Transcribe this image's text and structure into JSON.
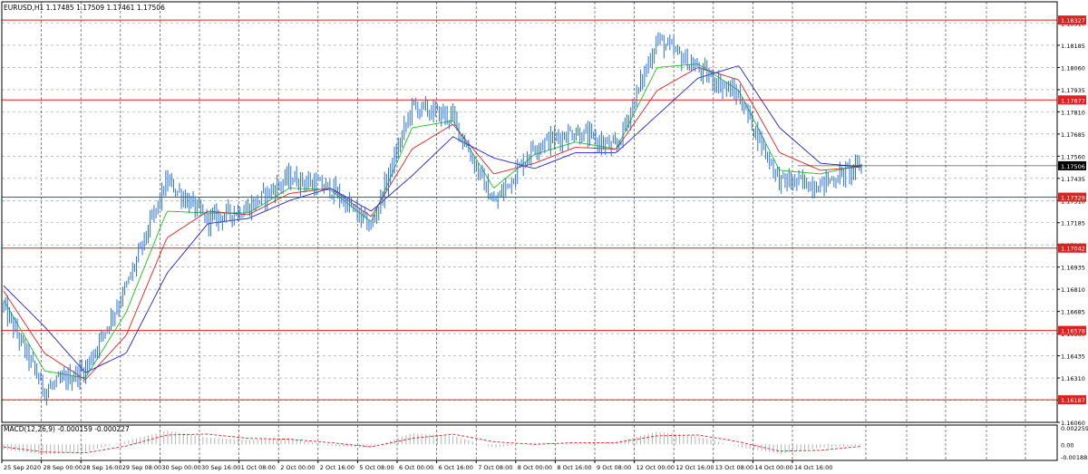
{
  "main_panel": {
    "header": "EURUSD,H1  1.17485 1.17509 1.17461 1.17506",
    "price_ticks": [
      "1.18310",
      "1.18185",
      "1.18060",
      "1.17935",
      "1.17810",
      "1.17685",
      "1.17560",
      "1.17435",
      "1.17310",
      "1.17185",
      "1.17060",
      "1.16935",
      "1.16810",
      "1.16685",
      "1.16560",
      "1.16435",
      "1.16310",
      "1.16185",
      "1.16060"
    ],
    "level_tags": [
      "1.18327",
      "1.17877",
      "1.17329",
      "1.17042",
      "1.16578",
      "1.16187"
    ],
    "current_price_tag": "1.17506"
  },
  "macd_panel": {
    "header": "MACD(12,26,9) -0.000159 -0.000227",
    "scale_ticks": [
      "0.002259",
      "0.00",
      "-0.001882"
    ]
  },
  "time_axis": {
    "labels": [
      "25 Sep 2020",
      "28 Sep 00:00",
      "28 Sep 16:00",
      "29 Sep 08:00",
      "30 Sep 00:00",
      "30 Sep 16:00",
      "1 Oct 08:00",
      "2 Oct 00:00",
      "2 Oct 16:00",
      "5 Oct 08:00",
      "6 Oct 00:00",
      "6 Oct 16:00",
      "7 Oct 08:00",
      "8 Oct 00:00",
      "8 Oct 16:00",
      "9 Oct 08:00",
      "12 Oct 00:00",
      "12 Oct 16:00",
      "13 Oct 08:00",
      "14 Oct 00:00",
      "14 Oct 16:00"
    ]
  },
  "colors": {
    "background": "#ffffff",
    "candles": "#2a72d8",
    "ma_fast": "#19c419",
    "ma_mid": "#e01f1f",
    "ma_slow": "#2020d8",
    "level_lines": "#e01f1f",
    "macd_signal": "#e01f1f",
    "macd_histogram": "#b4b4b4",
    "current_price_tag": "#000000",
    "grid": "#9a9a9a"
  },
  "chart_data": [
    {
      "type": "candlestick",
      "symbol": "EURUSD",
      "timeframe": "H1",
      "ohlc_last": {
        "open": 1.17485,
        "high": 1.17509,
        "low": 1.17461,
        "close": 1.17506
      },
      "ylim": [
        1.1606,
        1.1843
      ],
      "horizontal_levels": [
        1.18327,
        1.17877,
        1.17329,
        1.17042,
        1.16578,
        1.16187
      ],
      "current_price": 1.17506,
      "x": [
        "25 Sep 2020",
        "28 Sep 00:00",
        "28 Sep 16:00",
        "29 Sep 08:00",
        "30 Sep 00:00",
        "30 Sep 16:00",
        "1 Oct 08:00",
        "2 Oct 00:00",
        "2 Oct 16:00",
        "5 Oct 08:00",
        "6 Oct 00:00",
        "6 Oct 16:00",
        "7 Oct 08:00",
        "8 Oct 00:00",
        "8 Oct 16:00",
        "9 Oct 08:00",
        "12 Oct 00:00",
        "12 Oct 16:00",
        "13 Oct 08:00",
        "14 Oct 00:00",
        "14 Oct 16:00",
        "14 Oct 23:00"
      ],
      "close_path": [
        1.1671,
        1.1624,
        1.1636,
        1.1682,
        1.1742,
        1.172,
        1.1727,
        1.1744,
        1.1738,
        1.1716,
        1.1784,
        1.1778,
        1.1729,
        1.1762,
        1.177,
        1.176,
        1.1822,
        1.1805,
        1.179,
        1.1742,
        1.174,
        1.17506
      ],
      "moving_averages": [
        {
          "color": "green",
          "values": [
            1.1675,
            1.1635,
            1.1631,
            1.1668,
            1.1725,
            1.1724,
            1.1724,
            1.1738,
            1.1737,
            1.1719,
            1.1772,
            1.1776,
            1.1738,
            1.1757,
            1.1764,
            1.176,
            1.1806,
            1.1808,
            1.1793,
            1.1748,
            1.1746,
            1.1751
          ]
        },
        {
          "color": "red",
          "values": [
            1.168,
            1.1645,
            1.163,
            1.1655,
            1.171,
            1.1725,
            1.1723,
            1.1735,
            1.1738,
            1.1722,
            1.176,
            1.1774,
            1.1746,
            1.1752,
            1.1761,
            1.176,
            1.1793,
            1.1806,
            1.1799,
            1.1758,
            1.1748,
            1.175
          ]
        },
        {
          "color": "blue",
          "values": [
            1.1683,
            1.166,
            1.1634,
            1.1645,
            1.169,
            1.1718,
            1.1721,
            1.1731,
            1.1738,
            1.1725,
            1.1745,
            1.1767,
            1.1755,
            1.1749,
            1.1758,
            1.1758,
            1.1779,
            1.18,
            1.1807,
            1.1772,
            1.1752,
            1.175
          ]
        }
      ]
    },
    {
      "type": "bar",
      "title": "MACD(12,26,9)",
      "macd_main": -0.000159,
      "macd_signal": -0.000227,
      "ylim": [
        -0.001882,
        0.002259
      ],
      "x": [
        "25 Sep 2020",
        "28 Sep 00:00",
        "28 Sep 16:00",
        "29 Sep 08:00",
        "30 Sep 00:00",
        "30 Sep 16:00",
        "1 Oct 08:00",
        "2 Oct 00:00",
        "2 Oct 16:00",
        "5 Oct 08:00",
        "6 Oct 00:00",
        "6 Oct 16:00",
        "7 Oct 08:00",
        "8 Oct 00:00",
        "8 Oct 16:00",
        "9 Oct 08:00",
        "12 Oct 00:00",
        "12 Oct 16:00",
        "13 Oct 08:00",
        "14 Oct 00:00",
        "14 Oct 16:00",
        "14 Oct 23:00"
      ],
      "histogram": [
        -0.0006,
        -0.0012,
        -0.0009,
        0.0004,
        0.0016,
        0.0008,
        0.0005,
        0.0007,
        -0.0002,
        -0.0004,
        0.0013,
        0.001,
        -0.0004,
        0.0002,
        0.0001,
        0.0003,
        0.0015,
        0.0009,
        -0.0003,
        -0.0011,
        -0.0004,
        -0.00016
      ],
      "signal": [
        -0.0003,
        -0.0009,
        -0.001,
        -0.0002,
        0.0011,
        0.0012,
        0.0007,
        0.0006,
        0.0002,
        -0.0003,
        0.0007,
        0.0012,
        0.0003,
        0.0,
        0.0002,
        0.0002,
        0.001,
        0.0011,
        0.0003,
        -0.0008,
        -0.0007,
        -0.00023
      ]
    }
  ]
}
